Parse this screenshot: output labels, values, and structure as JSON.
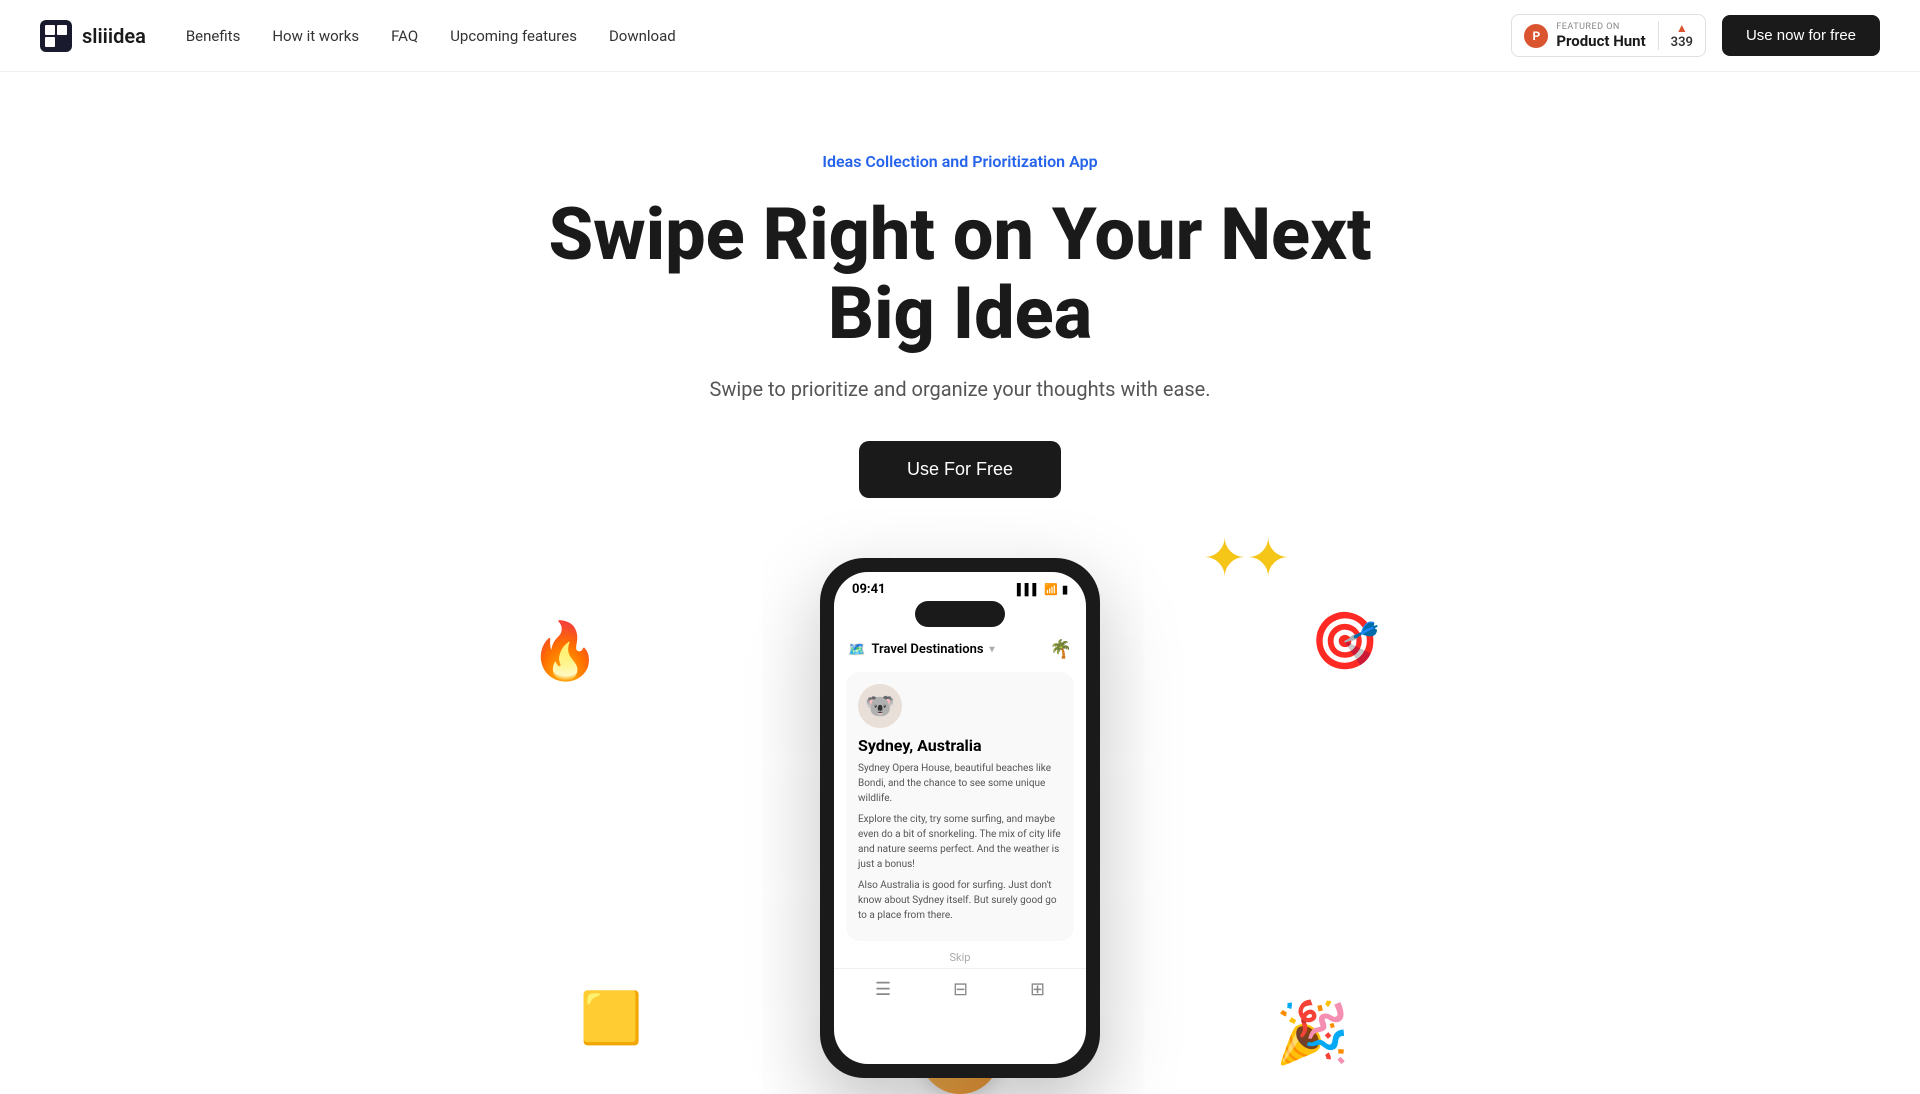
{
  "nav": {
    "logo_name": "sliiidea",
    "links": [
      {
        "id": "benefits",
        "label": "Benefits"
      },
      {
        "id": "how-it-works",
        "label": "How it works"
      },
      {
        "id": "faq",
        "label": "FAQ"
      },
      {
        "id": "upcoming-features",
        "label": "Upcoming features"
      },
      {
        "id": "download",
        "label": "Download"
      }
    ],
    "product_hunt": {
      "featured_label": "FEATURED ON",
      "name": "Product Hunt",
      "arrow": "▲",
      "score": "339"
    },
    "cta_label": "Use now for free"
  },
  "hero": {
    "tag": "Ideas Collection and Prioritization App",
    "title": "Swipe Right on Your Next Big Idea",
    "subtitle": "Swipe to prioritize and organize your thoughts with ease.",
    "cta_label": "Use For Free"
  },
  "phone": {
    "time": "09:41",
    "list_title": "Travel Destinations",
    "card_title": "Sydney, Australia",
    "card_text_1": "Sydney Opera House, beautiful beaches like Bondi, and the chance to see some unique wildlife.",
    "card_text_2": "Explore the city, try some surfing, and maybe even do a bit of snorkeling. The mix of city life and nature seems perfect. And the weather is just a bonus!",
    "card_text_3": "Also Australia is good for surfing. Just don't know about Sydney itself. But surely good go to a place from there.",
    "skip_label": "Skip"
  },
  "floating": {
    "sparkles": "✦✦",
    "fire": "🔥",
    "target": "🎯",
    "party": "🎉",
    "sticky": "🟨"
  }
}
